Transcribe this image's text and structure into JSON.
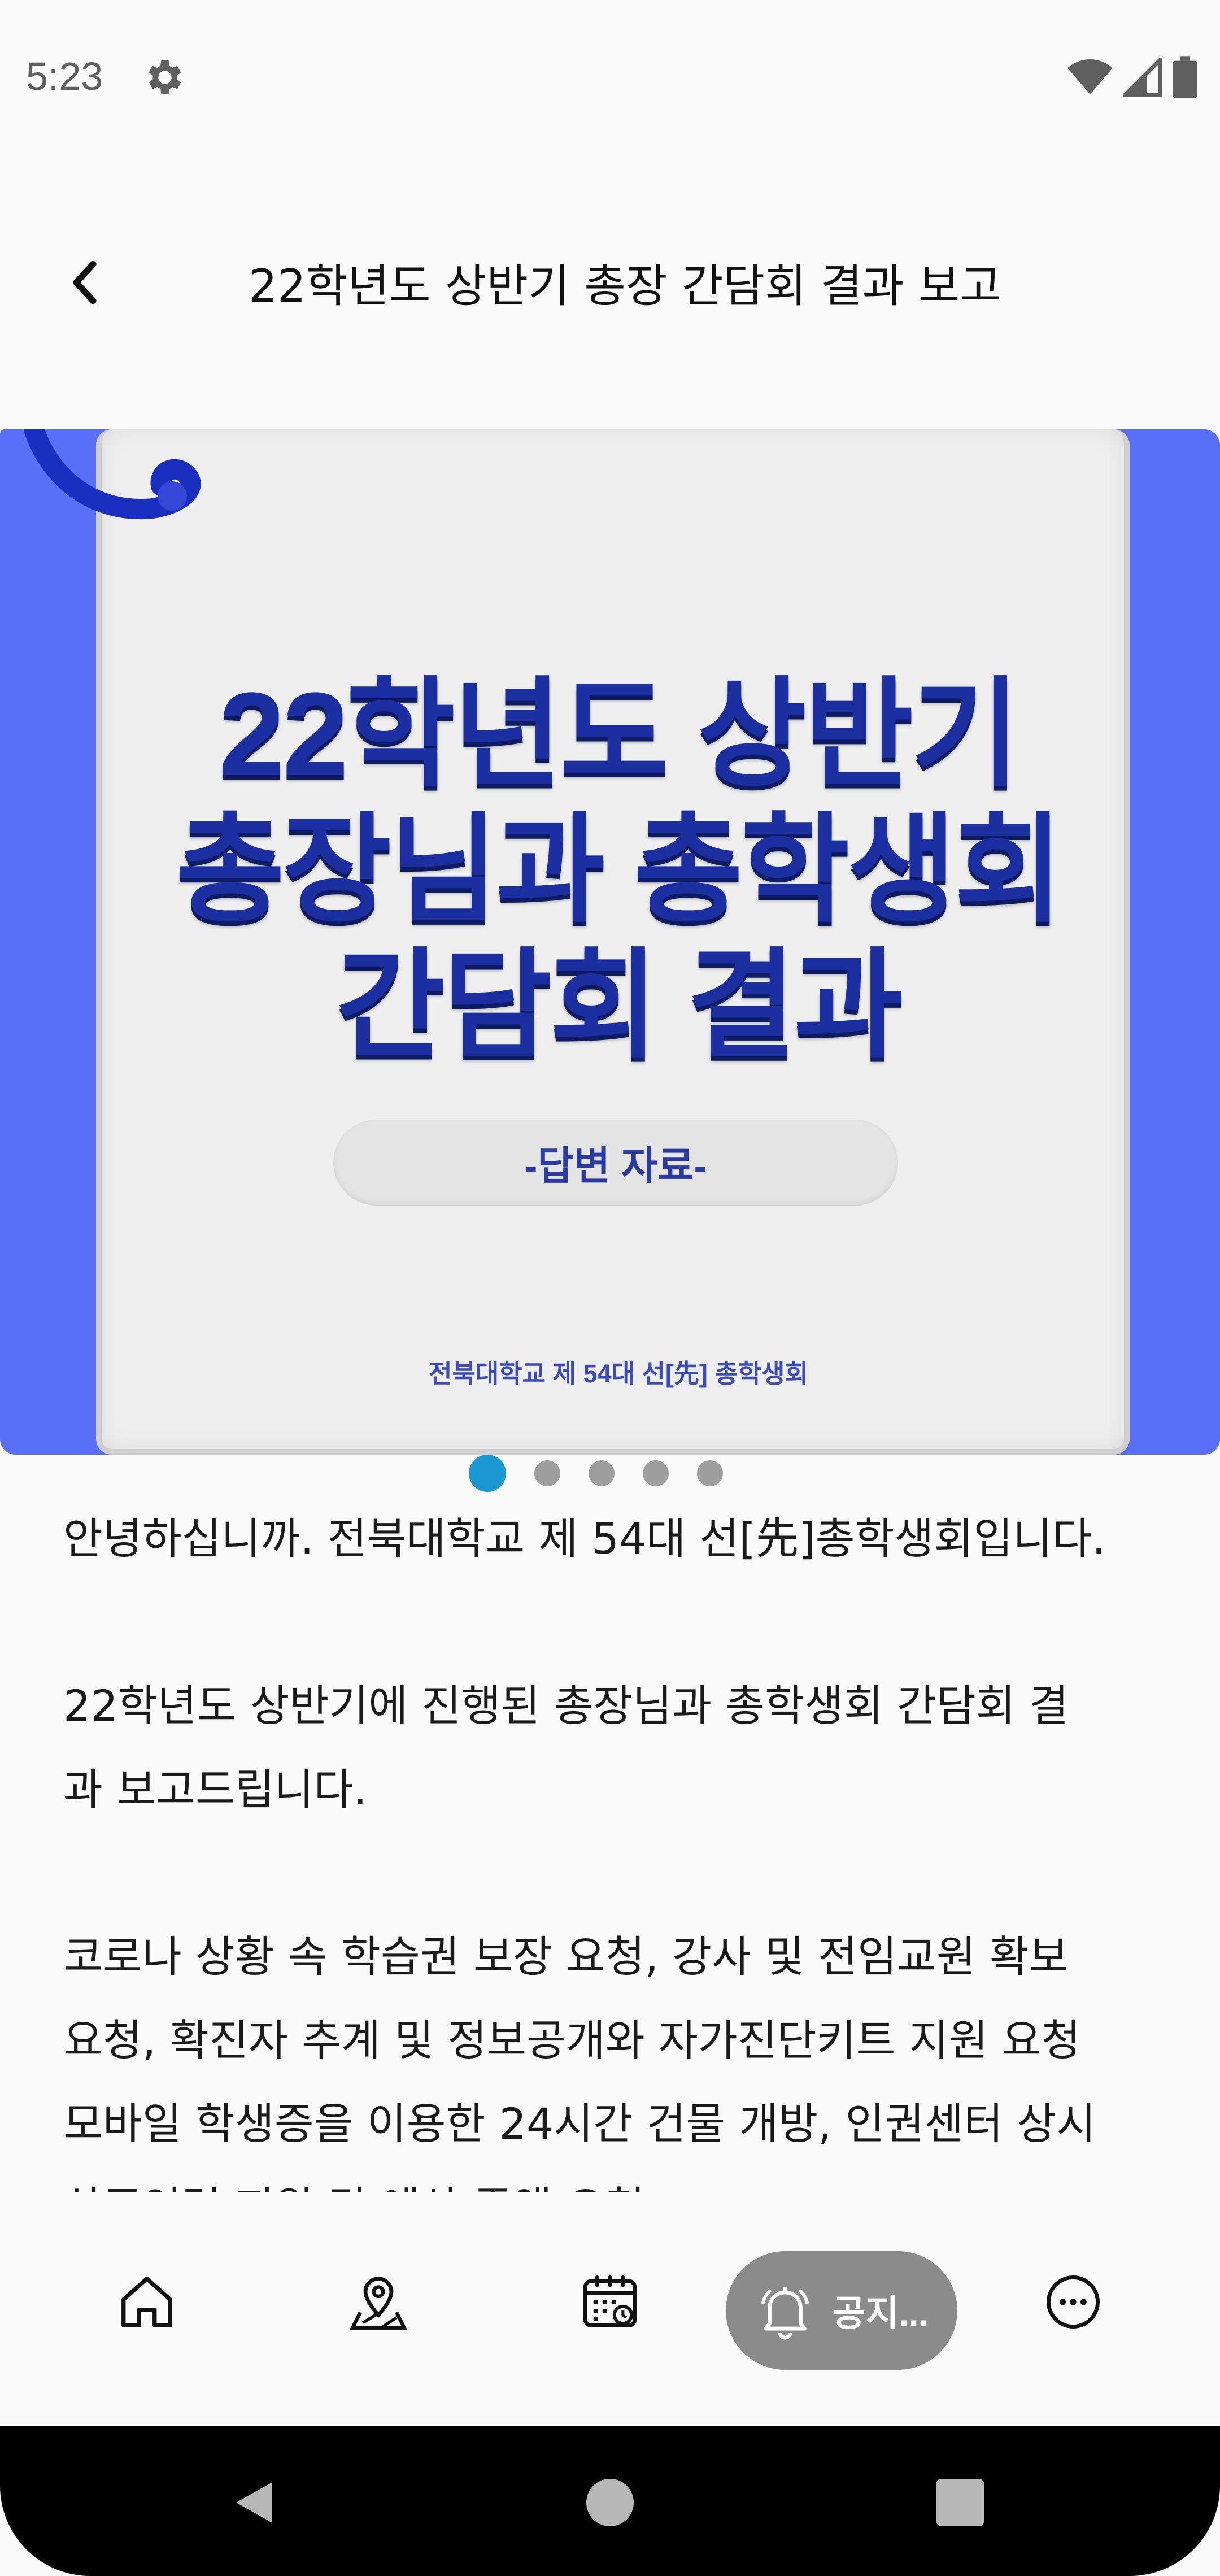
{
  "status_bar": {
    "time": "5:23",
    "icons": [
      "gear-icon",
      "wifi-icon",
      "signal-icon",
      "battery-icon"
    ]
  },
  "app_bar": {
    "back_icon": "chevron-left-icon",
    "title": "22학년도 상반기 총장 간담회 결과 보고"
  },
  "banner": {
    "headline_line1": "22학년도 상반기",
    "headline_line2": "총장님과 총학생회",
    "headline_line3": "간담회 결과",
    "pill_text": "-답변 자료-",
    "organization": "전북대학교 제 54대 선[先] 총학생회",
    "colors": {
      "background": "#5a6ff7",
      "headline": "#1b2fa0"
    }
  },
  "carousel": {
    "page_count": 5,
    "active_index": 0
  },
  "article": {
    "para1": "안녕하십니까. 전북대학교 제 54대 선[先]총학생회입니다.",
    "para2_line1": "22학년도 상반기에 진행된 총장님과 총학생회 간담회 결",
    "para2_line2": "과 보고드립니다.",
    "para3_line1": "코로나 상황 속 학습권 보장 요청, 강사 및 전임교원 확보",
    "para3_line2": "요청, 확진자 추계 및 정보공개와 자가진단키트 지원 요청",
    "para3_line3": "모바일 학생증을 이용한 24시간 건물 개방, 인권센터 상시",
    "para3_line4": "상주인력 지원 및 예산 증액 요청"
  },
  "bottom_nav": {
    "items": [
      {
        "icon": "home-icon"
      },
      {
        "icon": "map-pin-icon"
      },
      {
        "icon": "calendar-icon"
      },
      {
        "icon": "bell-icon",
        "label": "공지...",
        "active": true
      },
      {
        "icon": "more-icon"
      }
    ],
    "active_color": "#8b8b8b"
  },
  "system_nav": {
    "icons": [
      "back-triangle-icon",
      "home-circle-icon",
      "recents-square-icon"
    ]
  }
}
